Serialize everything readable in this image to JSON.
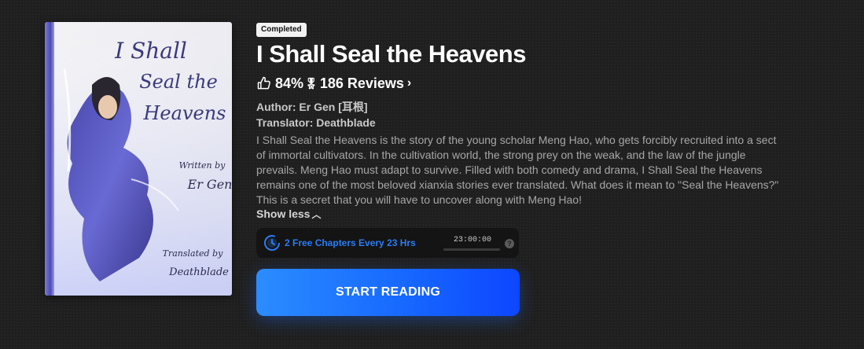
{
  "book": {
    "status_badge": "Completed",
    "title": "I Shall Seal the Heavens",
    "rating_percent": "84%",
    "reviews_label": "186 Reviews",
    "author_line": "Author: Er Gen [耳根]",
    "translator_line": "Translator: Deathblade",
    "description": "I Shall Seal the Heavens is the story of the young scholar Meng Hao, who gets forcibly recruited into a sect of immortal cultivators. In the cultivation world, the strong prey on the weak, and the law of the jungle prevails. Meng Hao must adapt to survive. Filled with both comedy and drama, I Shall Seal the Heavens remains one of the most beloved xianxia stories ever translated. What does it mean to \"Seal the Heavens?\" This is a secret that you will have to uncover along with Meng Hao!",
    "show_less_label": "Show less"
  },
  "cover": {
    "title_lines": [
      "I Shall",
      "Seal the",
      "Heavens"
    ],
    "written_line": "Written by",
    "author_short": "Er Gen",
    "translated_line": "Translated by",
    "translator_short": "Deathblade"
  },
  "free_chapters": {
    "label": "2 Free Chapters Every 23 Hrs",
    "timer": "23:00:00",
    "help": "?"
  },
  "cta": {
    "label": "START READING"
  },
  "icons": {
    "thumb": "thumbs-up-icon",
    "medal": "medal-icon",
    "chevron": "chevron-right-icon",
    "show_less_chevron": "chevron-up-icon",
    "clock": "clock-refresh-icon",
    "help": "help-icon"
  },
  "colors": {
    "accent": "#2b7cf5",
    "button_start": "#2b8cff",
    "button_end": "#0d46ff",
    "background": "#1f1f1f"
  }
}
